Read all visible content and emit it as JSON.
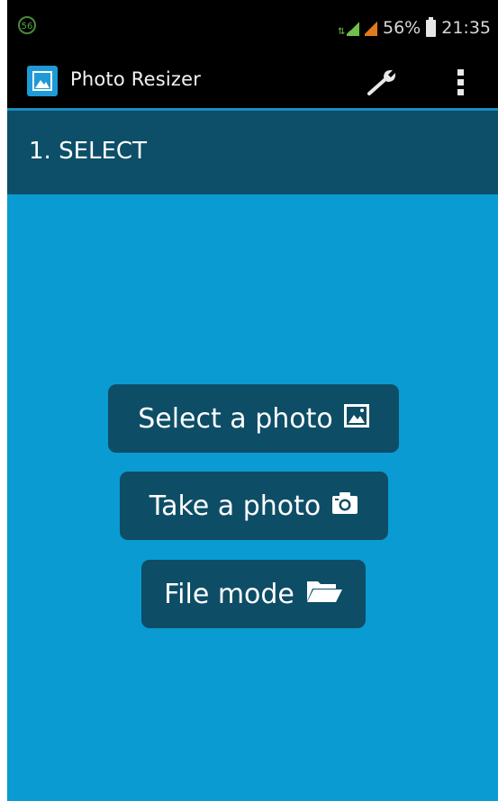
{
  "status_bar": {
    "notification": "56",
    "battery": "56%",
    "time": "21:35"
  },
  "action_bar": {
    "title": "Photo Resizer",
    "app_icon": "image-icon",
    "settings_icon": "wrench-icon",
    "overflow_icon": "overflow-menu-icon"
  },
  "section": {
    "title": "1. SELECT"
  },
  "buttons": {
    "select_photo": {
      "label": "Select a photo",
      "icon": "image-icon"
    },
    "take_photo": {
      "label": "Take a photo",
      "icon": "camera-icon"
    },
    "file_mode": {
      "label": "File mode",
      "icon": "folder-open-icon"
    }
  },
  "colors": {
    "background": "#0a9bd2",
    "header": "#0d4e68",
    "button": "#0e4d66",
    "bar": "#000000",
    "accent": "#1a8cc0"
  }
}
